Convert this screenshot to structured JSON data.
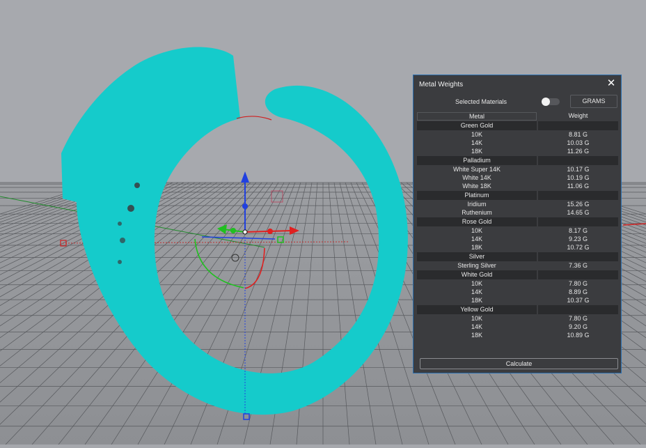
{
  "panel": {
    "title": "Metal Weights",
    "close_glyph": "✕",
    "selected_materials_label": "Selected Materials",
    "unit_button": "GRAMS",
    "calculate_button": "Calculate",
    "header": {
      "metal": "Metal",
      "weight": "Weight"
    },
    "groups": [
      {
        "name": "Green Gold",
        "rows": [
          {
            "metal": "10K",
            "weight": "8.81 G"
          },
          {
            "metal": "14K",
            "weight": "10.03 G"
          },
          {
            "metal": "18K",
            "weight": "11.26 G"
          }
        ]
      },
      {
        "name": "Palladium",
        "rows": [
          {
            "metal": "White Super 14K",
            "weight": "10.17 G"
          },
          {
            "metal": "White 14K",
            "weight": "10.19 G"
          },
          {
            "metal": "White 18K",
            "weight": "11.06 G"
          }
        ]
      },
      {
        "name": "Platinum",
        "rows": [
          {
            "metal": "Iridium",
            "weight": "15.26 G"
          },
          {
            "metal": "Ruthenium",
            "weight": "14.65 G"
          }
        ]
      },
      {
        "name": "Rose Gold",
        "rows": [
          {
            "metal": "10K",
            "weight": "8.17 G"
          },
          {
            "metal": "14K",
            "weight": "9.23 G"
          },
          {
            "metal": "18K",
            "weight": "10.72 G"
          }
        ]
      },
      {
        "name": "Silver",
        "rows": [
          {
            "metal": "Sterling Silver",
            "weight": "7.36 G"
          }
        ]
      },
      {
        "name": "White Gold",
        "rows": [
          {
            "metal": "10K",
            "weight": "7.80 G"
          },
          {
            "metal": "14K",
            "weight": "8.89 G"
          },
          {
            "metal": "18K",
            "weight": "10.37 G"
          }
        ]
      },
      {
        "name": "Yellow Gold",
        "rows": [
          {
            "metal": "10K",
            "weight": "7.80 G"
          },
          {
            "metal": "14K",
            "weight": "9.20 G"
          },
          {
            "metal": "18K",
            "weight": "10.89 G"
          }
        ]
      }
    ],
    "toggle_on": false
  },
  "viewport": {
    "background_color": "#a6a8ad",
    "ring_color": "#15cbcb",
    "grid_line_color": "#4a4c50",
    "icons": [
      "move-gizmo-icon",
      "rotate-gizmo-icon",
      "scale-gizmo-icon"
    ]
  }
}
